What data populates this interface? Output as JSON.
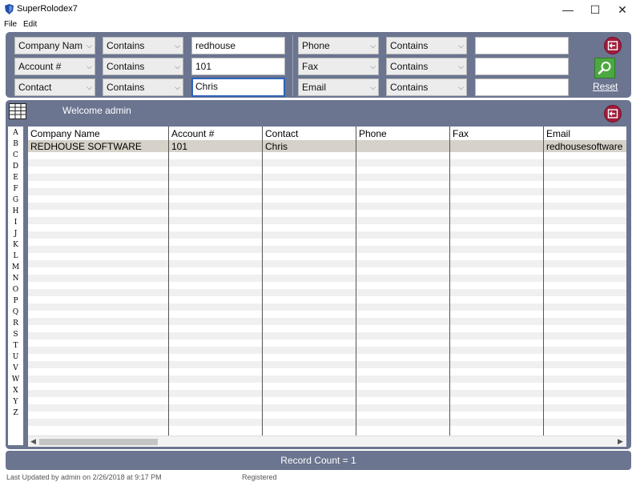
{
  "window": {
    "title": "SuperRolodex7",
    "minimize_glyph": "—",
    "maximize_glyph": "☐",
    "close_glyph": "✕"
  },
  "menu": [
    "File",
    "Edit"
  ],
  "filters": {
    "left": [
      {
        "field": "Company Nam",
        "operator": "Contains",
        "value": "redhouse"
      },
      {
        "field": "Account #",
        "operator": "Contains",
        "value": "101"
      },
      {
        "field": "Contact",
        "operator": "Contains",
        "value": "Chris"
      }
    ],
    "right": [
      {
        "field": "Phone",
        "operator": "Contains",
        "value": ""
      },
      {
        "field": "Fax",
        "operator": "Contains",
        "value": ""
      },
      {
        "field": "Email",
        "operator": "Contains",
        "value": ""
      }
    ],
    "reset_label": "Reset"
  },
  "welcome": "Welcome admin",
  "alphabet": [
    "A",
    "B",
    "C",
    "D",
    "E",
    "F",
    "G",
    "H",
    "I",
    "J",
    "K",
    "L",
    "M",
    "N",
    "O",
    "P",
    "Q",
    "R",
    "S",
    "T",
    "U",
    "V",
    "W",
    "X",
    "Y",
    "Z"
  ],
  "table": {
    "columns": [
      "Company Name",
      "Account #",
      "Contact",
      "Phone",
      "Fax",
      "Email"
    ],
    "rows": [
      [
        "REDHOUSE SOFTWARE",
        "101",
        "Chris",
        "",
        "",
        "redhousesoftware"
      ]
    ]
  },
  "record_count": "Record Count = 1",
  "status": {
    "last_updated": "Last Updated by admin on 2/26/2018 at 9:17 PM",
    "registration": "Registered"
  },
  "colors": {
    "panel": "#6b7590",
    "accent_red": "#a01c3c",
    "accent_green": "#4ca841",
    "selected_row": "#d7d2c9"
  }
}
